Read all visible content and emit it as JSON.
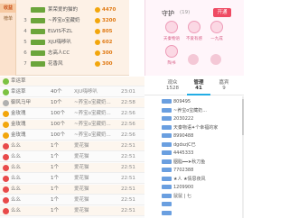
{
  "rank_tabs": [
    "收益",
    "榜单",
    "",
    "",
    "",
    "",
    "",
    ""
  ],
  "ranking": [
    {
      "num": "",
      "level": "",
      "name": "莱荣爱的猫的",
      "points": "4470"
    },
    {
      "num": "3",
      "level": "",
      "name": "~养宝o宝藏奶",
      "points": "3200"
    },
    {
      "num": "4",
      "level": "",
      "name": "ELVIS不ZL",
      "points": "805"
    },
    {
      "num": "5",
      "level": "",
      "name": "XjU嗨哆叭",
      "points": "602"
    },
    {
      "num": "6",
      "level": "",
      "name": "志高人CC",
      "points": "300"
    },
    {
      "num": "7",
      "level": "",
      "name": "花香风",
      "points": "300"
    }
  ],
  "gifts": [
    {
      "name": "幸运草",
      "count": "",
      "sender": "",
      "time": "",
      "color": "#7cc242"
    },
    {
      "name": "幸运草",
      "count": "40个",
      "sender": "XjU嗨哆叭",
      "time": "23:01",
      "color": "#7cc242"
    },
    {
      "name": "御风马甲",
      "count": "10个",
      "sender": "~养宝o宝藏奶...",
      "time": "22:58",
      "color": "#b0b0b0"
    },
    {
      "name": "金玫瑰",
      "count": "100个",
      "sender": "~养宝o宝藏奶...",
      "time": "22:56",
      "color": "#f2a60c"
    },
    {
      "name": "金玫瑰",
      "count": "100个",
      "sender": "~养宝o宝藏奶...",
      "time": "22:56",
      "color": "#f2a60c"
    },
    {
      "name": "金玫瑰",
      "count": "100个",
      "sender": "~养宝o宝藏奶...",
      "time": "22:56",
      "color": "#f2a60c"
    },
    {
      "name": "么么",
      "count": "1个",
      "sender": "爱花猫",
      "time": "22:51",
      "color": "#e84a4a"
    },
    {
      "name": "么么",
      "count": "1个",
      "sender": "爱花猫",
      "time": "22:51",
      "color": "#e84a4a"
    },
    {
      "name": "么么",
      "count": "1个",
      "sender": "爱花猫",
      "time": "22:51",
      "color": "#e84a4a"
    },
    {
      "name": "么么",
      "count": "1个",
      "sender": "爱花猫",
      "time": "22:51",
      "color": "#e84a4a"
    },
    {
      "name": "么么",
      "count": "1个",
      "sender": "爱花猫",
      "time": "22:51",
      "color": "#e84a4a"
    },
    {
      "name": "么么",
      "count": "1个",
      "sender": "爱花猫",
      "time": "22:51",
      "color": "#e84a4a"
    },
    {
      "name": "么么",
      "count": "1个",
      "sender": "爱花猫",
      "time": "22:51",
      "color": "#e84a4a"
    }
  ],
  "guard": {
    "title": "守护",
    "count": "(19)",
    "open_label": "开通",
    "users": [
      "天秦物语",
      "不爱有感",
      "一九成",
      "陶书"
    ]
  },
  "tabs": [
    {
      "label": "观众",
      "count": "1528"
    },
    {
      "label": "管理",
      "count": "41"
    },
    {
      "label": "嘉宾",
      "count": "9"
    },
    {
      "label": "",
      "count": ""
    }
  ],
  "members": [
    "809495",
    "~养宝o宝藏奶...",
    "2030222",
    "天秦物语✦个幸福的家",
    "8990488",
    "dgdszjC已",
    "4445333",
    "胭脂━━➤秋刀鱼",
    "7702388",
    "★人 ★情思夜风",
    "1209900",
    "鼠鼠 | 七",
    "",
    ""
  ]
}
